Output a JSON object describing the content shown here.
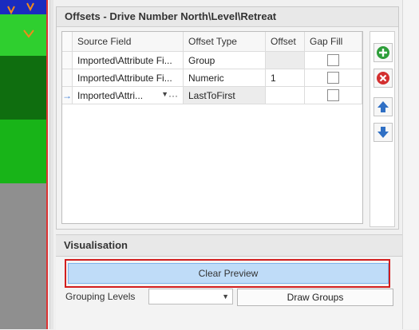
{
  "offsets_panel": {
    "title": "Offsets - Drive Number North\\Level\\Retreat",
    "columns": [
      "Source Field",
      "Offset Type",
      "Offset",
      "Gap Fill"
    ],
    "rows": [
      {
        "source_field": "Imported\\Attribute Fi...",
        "offset_type": "Group",
        "offset": "",
        "gap_fill": false
      },
      {
        "source_field": "Imported\\Attribute Fi...",
        "offset_type": "Numeric",
        "offset": "1",
        "gap_fill": false
      },
      {
        "source_field": "Imported\\Attri...",
        "offset_type": "LastToFirst",
        "offset": "",
        "gap_fill": false
      }
    ],
    "current_row_marker": "→",
    "ellipsis": "···"
  },
  "toolbar": {
    "icons": [
      "add-icon",
      "remove-icon",
      "move-up-icon",
      "move-down-icon"
    ],
    "colors": {
      "add": "#2e9e3a",
      "remove": "#d32f2f",
      "move": "#2f6fc4"
    }
  },
  "visualisation": {
    "title": "Visualisation",
    "clear_preview_label": "Clear Preview",
    "grouping_levels_label": "Grouping Levels",
    "grouping_levels_value": "",
    "draw_groups_label": "Draw Groups"
  }
}
